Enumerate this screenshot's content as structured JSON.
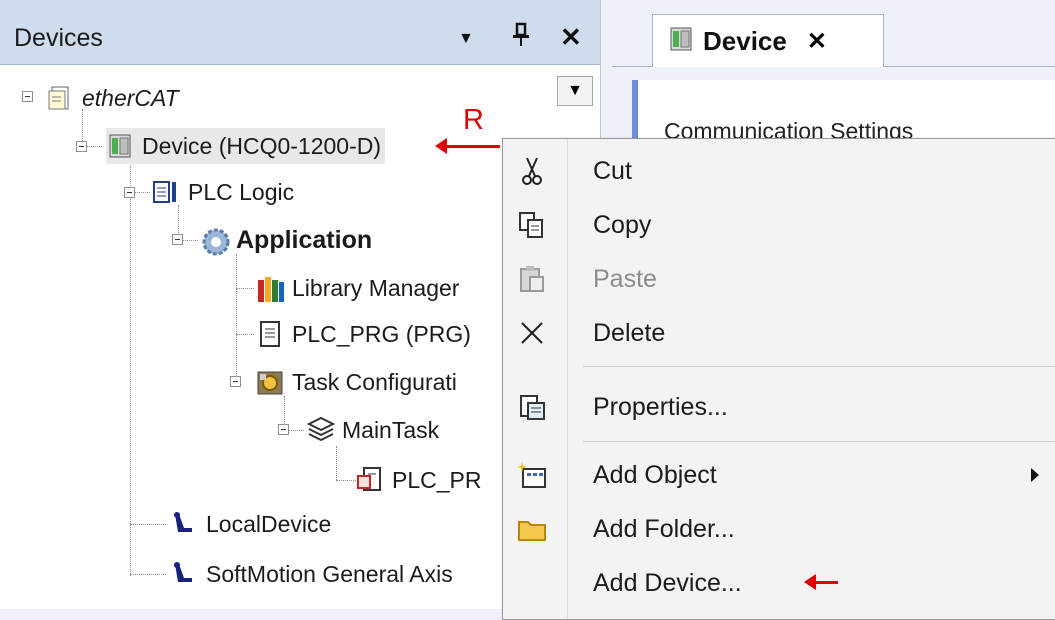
{
  "devices_panel": {
    "title": "Devices",
    "controls": {
      "dropdown": "▼",
      "pin": "ᵖ",
      "close": "✕"
    }
  },
  "tree": {
    "root": "etherCAT",
    "device": "Device (HCQ0-1200-D)",
    "plc_logic": "PLC Logic",
    "application": "Application",
    "library_manager": "Library Manager",
    "plc_prg": "PLC_PRG (PRG)",
    "task_configuration": "Task Configurati",
    "main_task": "MainTask",
    "plc_prg_call": "PLC_PR",
    "local_device": "LocalDevice",
    "softmotion_axis": "SoftMotion General Axis"
  },
  "editor": {
    "tab_label": "Device",
    "tab_close": "✕",
    "section_title": "Communication Settings"
  },
  "context_menu": {
    "cut": "Cut",
    "copy": "Copy",
    "paste": "Paste",
    "delete": "Delete",
    "properties": "Properties...",
    "add_object": "Add Object",
    "add_folder": "Add Folder...",
    "add_device": "Add Device..."
  },
  "annotations": {
    "right_click_marker": "R",
    "arrow_color": "#e00000"
  },
  "colors": {
    "header_bg": "#cfdcee",
    "editor_accent": "#6b8fd6"
  }
}
